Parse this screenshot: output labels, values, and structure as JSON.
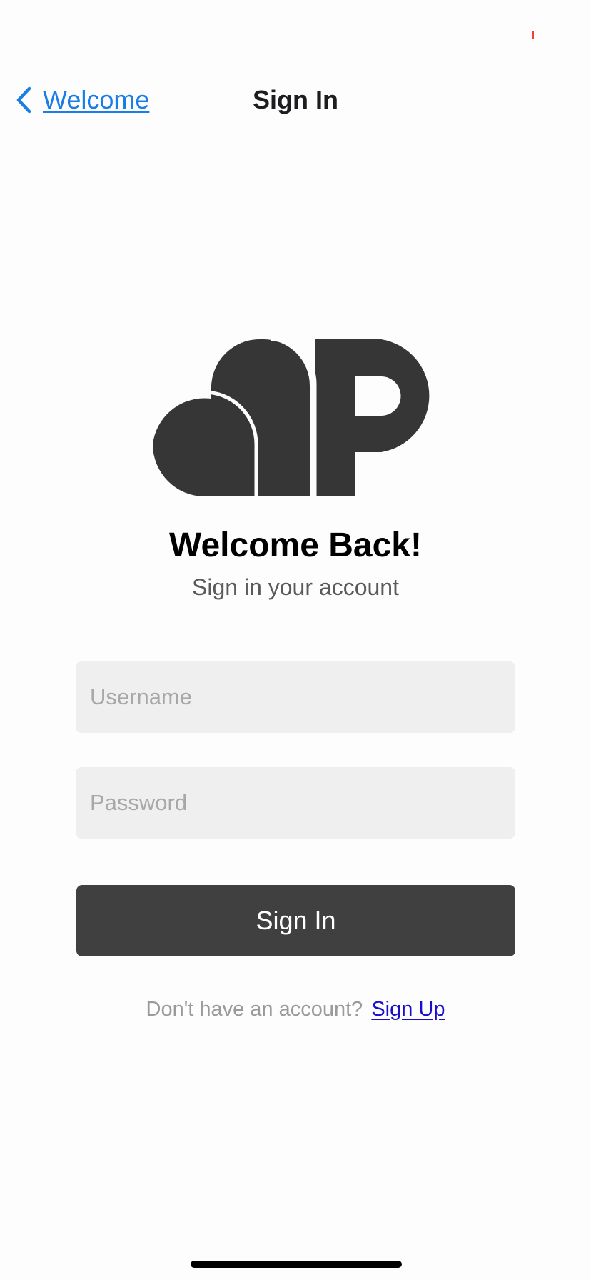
{
  "nav": {
    "back_label": "Welcome",
    "title": "Sign In",
    "back_icon": "chevron-left-icon"
  },
  "logo": {
    "name": "app-logo",
    "color": "#363636"
  },
  "header": {
    "headline": "Welcome Back!",
    "subtitle": "Sign in your account"
  },
  "form": {
    "username": {
      "placeholder": "Username",
      "value": ""
    },
    "password": {
      "placeholder": "Password",
      "value": ""
    },
    "submit_label": "Sign In"
  },
  "footer": {
    "prompt": "Don't have an account?",
    "signup_label": "Sign Up"
  },
  "colors": {
    "accent": "#1a7ee6",
    "button": "#404040",
    "field_background": "#efefef",
    "link": "#1a0dcc"
  }
}
